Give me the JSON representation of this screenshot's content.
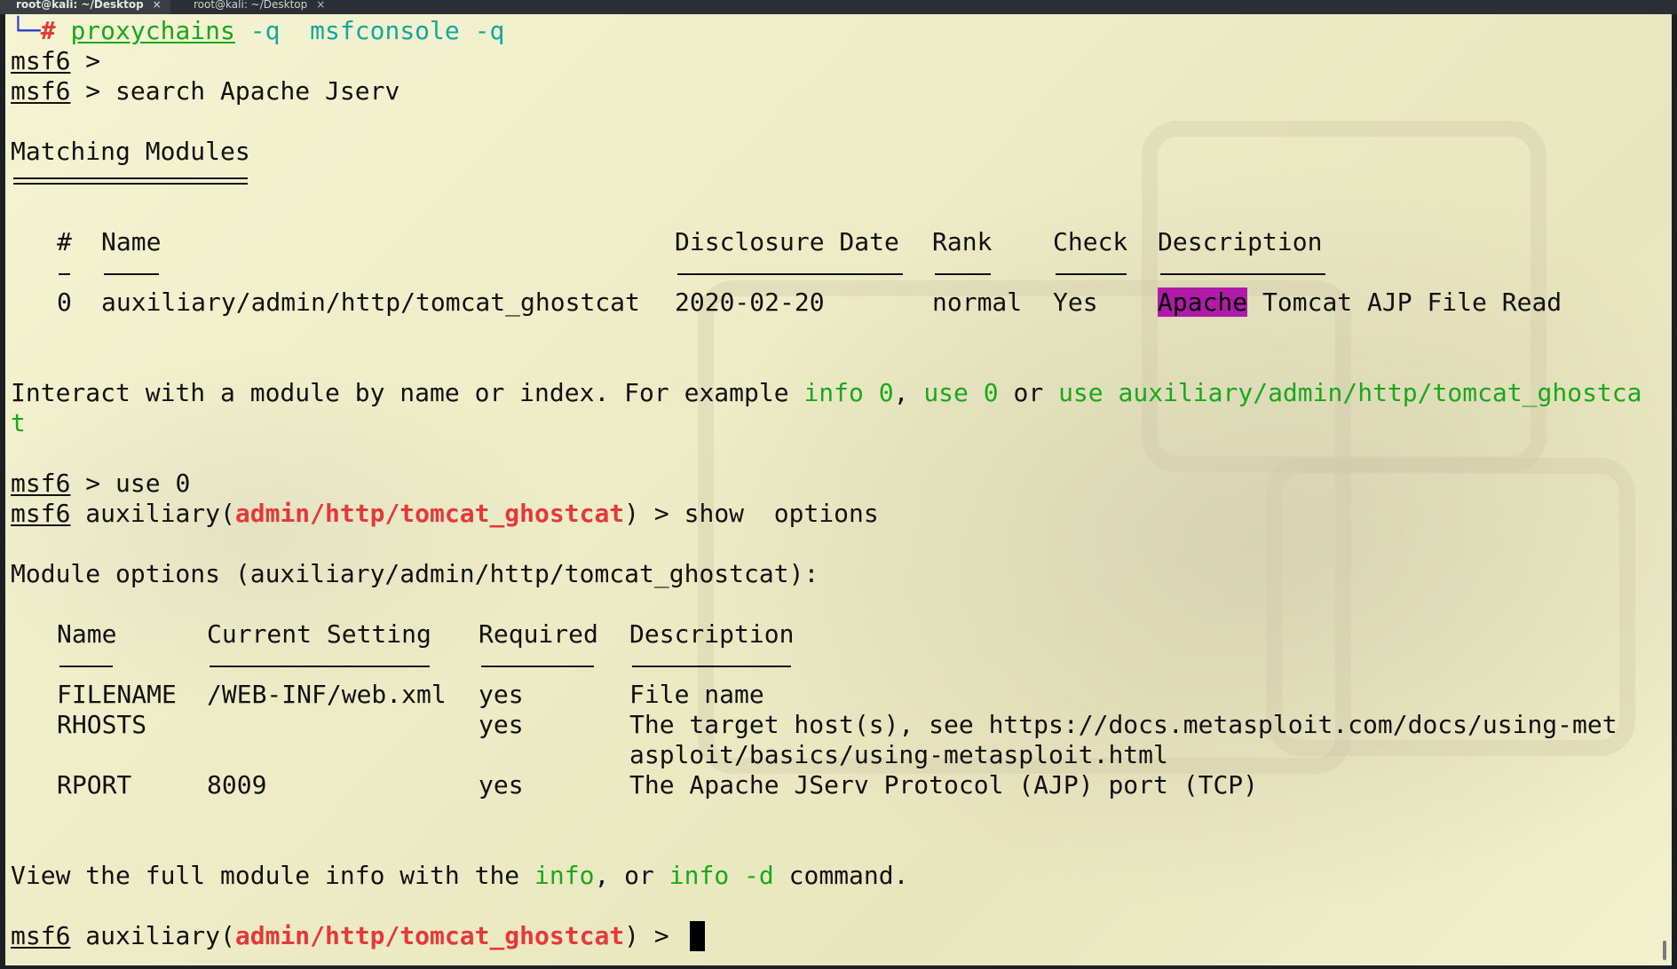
{
  "tabs": [
    {
      "label": "root@kali: ~/Desktop",
      "close": "×",
      "active": true
    },
    {
      "label": "root@kali: ~/Desktop",
      "close": "×",
      "active": false
    }
  ],
  "terminal": {
    "cmd_line": {
      "corner": "└─",
      "hash": "#",
      "cmd": "proxychains",
      "args": " -q  ",
      "cmd2": "msfconsole -q"
    },
    "prompt_msf": "msf6",
    "prompt_gt": " >",
    "search_cmd": " > search Apache Jserv",
    "matching_title": "Matching Modules",
    "search_headers": {
      "num": "#",
      "name": "Name",
      "date": "Disclosure Date",
      "rank": "Rank",
      "check": "Check",
      "desc": "Description"
    },
    "search_row": {
      "num": "0",
      "name": "auxiliary/admin/http/tomcat_ghostcat",
      "date": "2020-02-20",
      "rank": "normal",
      "check": "Yes",
      "desc_highlight": "Apache",
      "desc_rest": " Tomcat AJP File Read"
    },
    "interact": {
      "prefix": "Interact with a module by name or index. For example ",
      "info0": "info 0",
      "comma": ", ",
      "use0": "use 0",
      "or": " or ",
      "use_full": "use auxiliary/admin/http/tomcat_ghostca",
      "use_full_wrap": "t"
    },
    "use_cmd": " > use 0",
    "aux_prefix": " auxiliary(",
    "module_path": "admin/http/tomcat_ghostcat",
    "aux_suffix": ") > ",
    "show_cmd": "show  options",
    "module_options_title": "Module options (auxiliary/admin/http/tomcat_ghostcat):",
    "options_headers": {
      "name": "Name",
      "setting": "Current Setting",
      "required": "Required",
      "desc": "Description"
    },
    "options_rows": [
      {
        "name": "FILENAME",
        "setting": "/WEB-INF/web.xml",
        "required": "yes",
        "desc": "File name",
        "desc2": ""
      },
      {
        "name": "RHOSTS",
        "setting": "",
        "required": "yes",
        "desc": "The target host(s), see https://docs.metasploit.com/docs/using-met",
        "desc2": "asploit/basics/using-metasploit.html"
      },
      {
        "name": "RPORT",
        "setting": "8009",
        "required": "yes",
        "desc": "The Apache JServ Protocol (AJP) port (TCP)",
        "desc2": ""
      }
    ],
    "view_info": {
      "prefix": "View the full module info with the ",
      "info": "info",
      "mid": ", or ",
      "info_d": "info -d",
      "suffix": " command."
    },
    "final_suffix": ") > "
  },
  "colors": {
    "green": "#1aa81a",
    "red": "#e53939",
    "highlight": "#b01aa8",
    "background": "#f2f1cd"
  }
}
